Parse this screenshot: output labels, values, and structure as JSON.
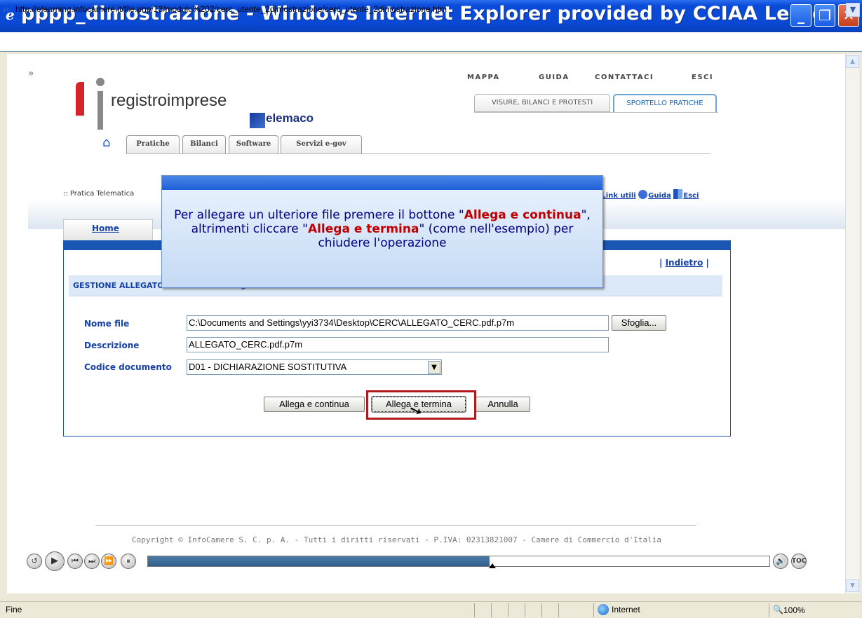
{
  "window": {
    "title": "pppp_dimostrazione - Windows Internet Explorer provided by CCIAA Lecce",
    "url": "http://elearning.infocamere.it/file.php/13/modulo%202/cerc_utente_2dimostrazione/cerc_utente_2dimostrazione.htm"
  },
  "site": {
    "expand_icon": "»",
    "top_links": [
      "MAPPA",
      "GUIDA",
      "CONTATTACI",
      "ESCI"
    ],
    "top_tabs": [
      "VISURE, BILANCI E PROTESTI",
      "SPORTELLO PRATICHE"
    ],
    "logo_text": "registroimprese",
    "telemaco_text": "elemaco",
    "nav_tabs": [
      "Pratiche",
      "Bilanci",
      "Software",
      "Servizi e-gov"
    ],
    "pratica_label": ":: Pratica Telematica",
    "right_links": {
      "prefix": "s",
      "link_utili": "Link utili",
      "guida": "Guida",
      "esci": "Esci"
    },
    "home_tab": "Home",
    "indietro": "Indietro",
    "section_title": "GESTIONE ALLEGATO: Inserimento allegato"
  },
  "form": {
    "nome_file_label": "Nome file",
    "nome_file_value": "C:\\Documents and Settings\\yyi3734\\Desktop\\CERC\\ALLEGATO_CERC.pdf.p7m",
    "browse_label": "Sfoglia...",
    "descrizione_label": "Descrizione",
    "descrizione_value": "ALLEGATO_CERC.pdf.p7m",
    "codice_label": "Codice documento",
    "codice_value": "D01 - DICHIARAZIONE SOSTITUTIVA",
    "btn_continua": "Allega e continua",
    "btn_termina": "Allega e termina",
    "btn_annulla": "Annulla"
  },
  "popup": {
    "text_1": "Per allegare un ulteriore file premere il bottone \"",
    "bold_1": "Allega e continua",
    "text_2": "\", altrimenti cliccare \"",
    "bold_2": "Allega e termina",
    "text_3": "\" (come nell'esempio) per chiudere l'operazione"
  },
  "footer": {
    "copyright": "Copyright © InfoCamere S. C. p. A. - Tutti i diritti riservati - P.IVA: 02313821007 - Camere di Commercio d'Italia"
  },
  "player": {
    "progress": 0.55,
    "volume_label": "🔊",
    "toc_label": "TOC"
  },
  "status": {
    "text": "Fine",
    "zone": "Internet",
    "zoom": "100%"
  }
}
